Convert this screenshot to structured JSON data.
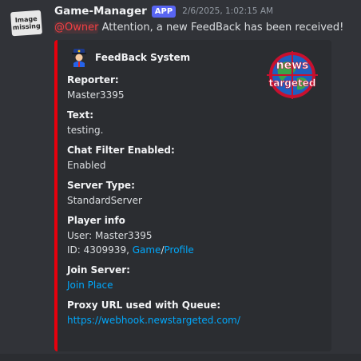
{
  "avatar": {
    "alt_line1": "Image",
    "alt_line2": "missing"
  },
  "message": {
    "username": "Game-Manager",
    "badge": "APP",
    "timestamp": "2/6/2025, 1:02:15 AM",
    "mention": "@Owner",
    "text": " Attention, a new FeedBack has been received!"
  },
  "embed": {
    "accent_color": "#e7000d",
    "author": {
      "name": "FeedBack System",
      "icon": "police-officer-icon"
    },
    "thumbnail": {
      "icon": "news-targeted-logo",
      "line1": "news",
      "line2": "targeted"
    },
    "fields": {
      "reporter": {
        "name": "Reporter:",
        "value": "Master3395"
      },
      "text": {
        "name": "Text:",
        "value": "testing."
      },
      "chat_filter": {
        "name": "Chat Filter Enabled:",
        "value": "Enabled"
      },
      "server_type": {
        "name": "Server Type:",
        "value": "StandardServer"
      },
      "player_info": {
        "name": "Player info",
        "user_line": "User: Master3395",
        "id_prefix": "ID: 4309939, ",
        "game_link": "Game",
        "separator": "/",
        "profile_link": "Profile"
      },
      "join_server": {
        "name": "Join Server:",
        "link": "Join Place"
      },
      "proxy_url": {
        "name": "Proxy URL used with Queue:",
        "link": "https://webhook.newstargeted.com/"
      }
    }
  }
}
